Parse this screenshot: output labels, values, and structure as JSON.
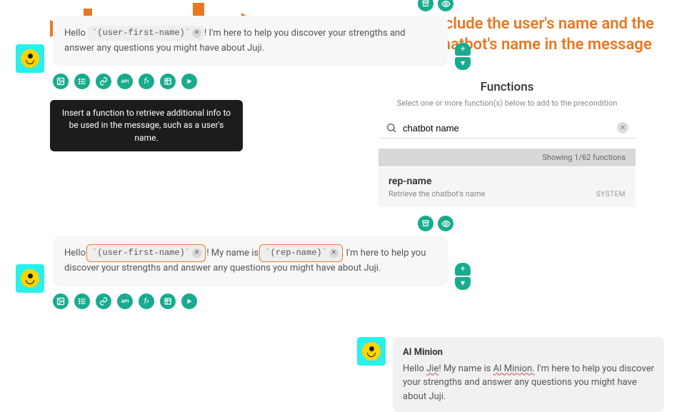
{
  "annotation": "Include the user's name and the chatbot's name in the message",
  "tooltip_text": "Insert a function to retrieve additional info to be used in the message, such as a user's name.",
  "message1": {
    "hello": "Hello",
    "token_user": "`(user-first-name)`",
    "rest": "! I'm here to help you discover your strengths and answer any questions you might have about Juji."
  },
  "message2": {
    "hello": "Hello",
    "token_user": "`(user-first-name)`",
    "middle": "! My name is",
    "token_rep": "`(rep-name)`",
    "rest": ". I'm here to help you discover your strengths and answer any questions you might have about Juji."
  },
  "functions_panel": {
    "title": "Functions",
    "subtitle": "Select one or more function(s) below to add to the precondition",
    "search_value": "chatbot name",
    "count_label": "Showing 1/62 functions",
    "item_name": "rep-name",
    "item_desc": "Retrieve the chatbot's name",
    "item_tag": "SYSTEM"
  },
  "result": {
    "bot_name": "AI Minion",
    "text_prefix": "Hello ",
    "hl1": "Jie",
    "text_mid": "! My name is ",
    "hl2": "AI Minion.",
    "text_suffix": " I'm here to help you discover your strengths and answer any questions you might have about Juji."
  },
  "icons": {
    "plus": "+",
    "chevron_down": "▾"
  }
}
